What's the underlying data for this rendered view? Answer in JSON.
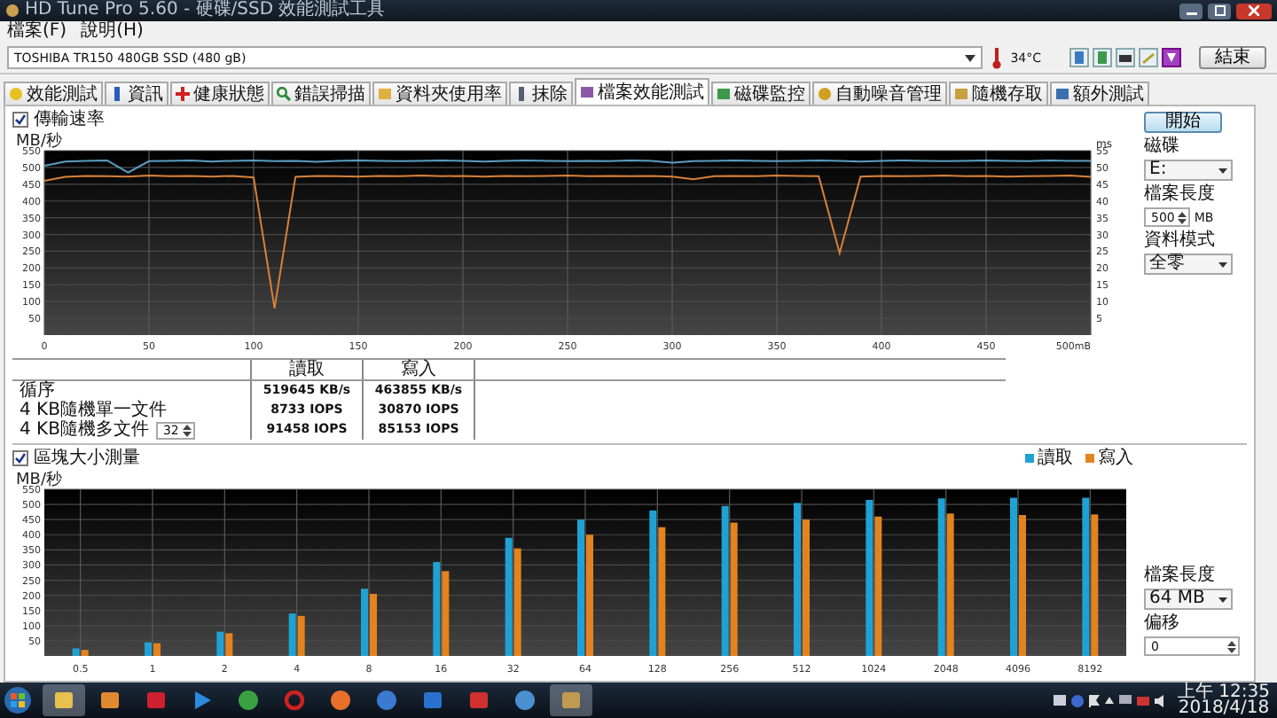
{
  "window": {
    "title": "HD Tune Pro 5.60 - 硬碟/SSD 效能測試工具"
  },
  "menu": [
    "檔案(F)",
    "說明(H)"
  ],
  "drive": {
    "value": "TOSHIBA TR150 480GB SSD (480 gB)",
    "temperature": "34°C",
    "exit_button": "結束"
  },
  "tabs": [
    {
      "label": "效能測試",
      "selected": false
    },
    {
      "label": "資訊",
      "selected": false
    },
    {
      "label": "健康狀態",
      "selected": false
    },
    {
      "label": "錯誤掃描",
      "selected": false
    },
    {
      "label": "資料夾使用率",
      "selected": false
    },
    {
      "label": "抹除",
      "selected": false
    },
    {
      "label": "檔案效能測試",
      "selected": true
    },
    {
      "label": "磁碟監控",
      "selected": false
    },
    {
      "label": "自動噪音管理",
      "selected": false
    },
    {
      "label": "隨機存取",
      "selected": false
    },
    {
      "label": "額外測試",
      "selected": false
    }
  ],
  "file_benchmark": {
    "transfer_rate": {
      "label": "傳輸速率",
      "checked": true,
      "chart_data": {
        "type": "line",
        "grid": true,
        "ylabel": "MB/秒",
        "xlim": [
          0,
          500
        ],
        "ylim": [
          0,
          550
        ],
        "x": [
          0,
          10,
          20,
          30,
          40,
          50,
          60,
          70,
          80,
          90,
          100,
          110,
          120,
          130,
          140,
          150,
          160,
          170,
          180,
          190,
          200,
          210,
          220,
          230,
          240,
          250,
          260,
          270,
          280,
          290,
          300,
          310,
          320,
          330,
          340,
          350,
          360,
          370,
          380,
          390,
          400,
          410,
          420,
          430,
          440,
          450,
          460,
          470,
          480,
          490,
          500
        ],
        "xticks": [
          0,
          50,
          100,
          150,
          200,
          250,
          300,
          350,
          400,
          450,
          {
            "value": 500,
            "label": "500mB"
          }
        ],
        "yticks": [
          50,
          100,
          150,
          200,
          250,
          300,
          350,
          400,
          450,
          500,
          550
        ],
        "y2label": "ms",
        "y2lim": [
          0,
          55
        ],
        "y2ticks": [
          5,
          10,
          15,
          20,
          25,
          30,
          35,
          40,
          45,
          50,
          55
        ],
        "series": [
          {
            "color": "#5b9ec4",
            "values": [
              505,
              518,
              520,
              521,
              485,
              519,
              520,
              521,
              518,
              520,
              521,
              519,
              520,
              517,
              520,
              521,
              520,
              519,
              520,
              521,
              520,
              518,
              520,
              521,
              520,
              519,
              520,
              519,
              521,
              520,
              514,
              519,
              520,
              521,
              520,
              519,
              520,
              521,
              520,
              518,
              520,
              521,
              520,
              519,
              520,
              521,
              520,
              519,
              521,
              520,
              520
            ]
          },
          {
            "color": "#d9813a",
            "values": [
              460,
              472,
              475,
              474,
              473,
              476,
              474,
              475,
              473,
              475,
              470,
              80,
              472,
              475,
              474,
              473,
              475,
              474,
              476,
              474,
              475,
              473,
              475,
              474,
              475,
              476,
              474,
              475,
              474,
              475,
              473,
              465,
              474,
              475,
              474,
              476,
              475,
              474,
              245,
              473,
              475,
              474,
              475,
              476,
              474,
              475,
              473,
              474,
              475,
              476,
              472
            ]
          }
        ]
      }
    },
    "results": {
      "columns": [
        "讀取",
        "寫入"
      ],
      "rows": [
        {
          "label": "循序",
          "read": "519645 KB/s",
          "write": "463855 KB/s"
        },
        {
          "label": "4 KB隨機單一文件",
          "read": "8733 IOPS",
          "write": "30870 IOPS"
        },
        {
          "label": "4 KB隨機多文件",
          "queue_depth": "32",
          "read": "91458 IOPS",
          "write": "85153 IOPS"
        }
      ]
    },
    "block_size": {
      "label": "區塊大小測量",
      "checked": true,
      "chart_data": {
        "type": "bar",
        "grid": true,
        "ylabel": "MB/秒",
        "ylim": [
          0,
          550
        ],
        "categories": [
          "0.5",
          "1",
          "2",
          "4",
          "8",
          "16",
          "32",
          "64",
          "128",
          "256",
          "512",
          "1024",
          "2048",
          "4096",
          "8192"
        ],
        "yticks": [
          50,
          100,
          150,
          200,
          250,
          300,
          350,
          400,
          450,
          500,
          550
        ],
        "series": [
          {
            "name": "讀取",
            "color": "#1ea2d4",
            "values": [
              25,
              45,
              80,
              140,
              222,
              310,
              390,
              450,
              480,
              495,
              505,
              515,
              520,
              522,
              522
            ]
          },
          {
            "name": "寫入",
            "color": "#e3831f",
            "values": [
              20,
              42,
              75,
              132,
              205,
              280,
              355,
              400,
              425,
              440,
              450,
              460,
              470,
              465,
              467
            ]
          }
        ]
      }
    }
  },
  "controls": {
    "start_button": "開始",
    "drive_label": "磁碟",
    "drive_value": "E:",
    "file_length_label": "檔案長度",
    "file_length_value": "500",
    "file_length_unit": "MB",
    "data_mode_label": "資料模式",
    "data_mode_value": "全零"
  },
  "block_controls": {
    "file_length_label": "檔案長度",
    "file_length_value": "64 MB",
    "offset_label": "偏移",
    "offset_value": "0"
  },
  "taskbar": {
    "time": "上午 12:35",
    "date": "2018/4/18"
  }
}
